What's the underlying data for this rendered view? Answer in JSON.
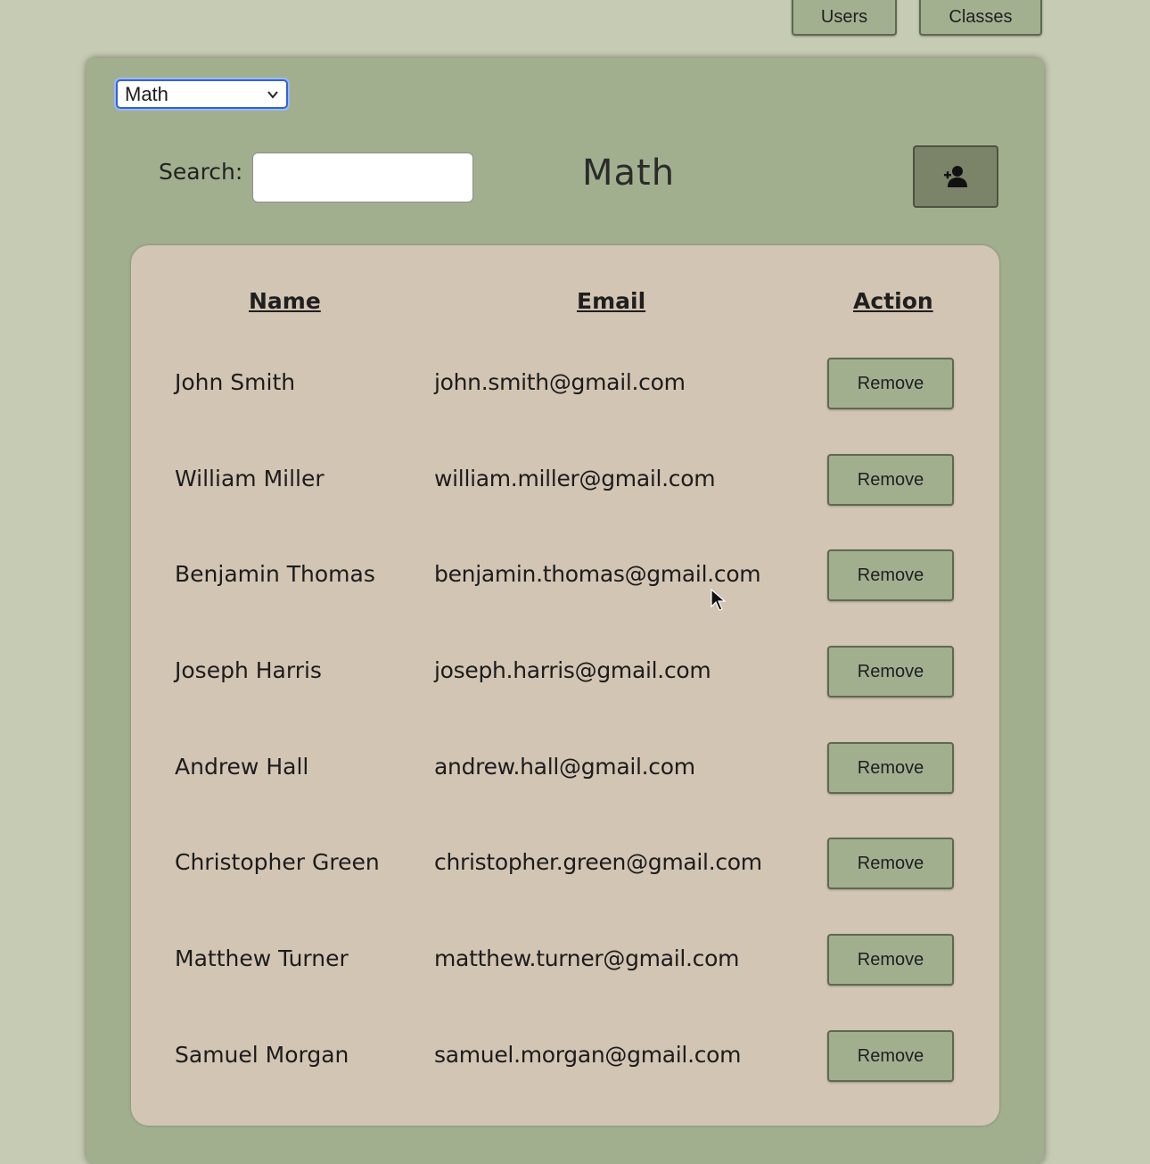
{
  "nav": {
    "users_label": "Users",
    "classes_label": "Classes"
  },
  "class_select": {
    "selected": "Math"
  },
  "search": {
    "label": "Search:",
    "value": ""
  },
  "title": "Math",
  "add_button_icon": "add-user-icon",
  "table": {
    "headers": {
      "name": "Name",
      "email": "Email",
      "action": "Action"
    },
    "rows": [
      {
        "name": "John Smith",
        "email": "john.smith@gmail.com",
        "action": "Remove"
      },
      {
        "name": "William Miller",
        "email": "william.miller@gmail.com",
        "action": "Remove"
      },
      {
        "name": "Benjamin Thomas",
        "email": "benjamin.thomas@gmail.com",
        "action": "Remove"
      },
      {
        "name": "Joseph Harris",
        "email": "joseph.harris@gmail.com",
        "action": "Remove"
      },
      {
        "name": "Andrew Hall",
        "email": "andrew.hall@gmail.com",
        "action": "Remove"
      },
      {
        "name": "Christopher Green",
        "email": "christopher.green@gmail.com",
        "action": "Remove"
      },
      {
        "name": "Matthew Turner",
        "email": "matthew.turner@gmail.com",
        "action": "Remove"
      },
      {
        "name": "Samuel Morgan",
        "email": "samuel.morgan@gmail.com",
        "action": "Remove"
      }
    ]
  },
  "colors": {
    "page_bg": "#c6cbb3",
    "panel_bg": "#a2af8f",
    "table_bg": "#d3c5b3",
    "button_bg": "#a2af8f",
    "add_button_bg": "#7b8468"
  }
}
